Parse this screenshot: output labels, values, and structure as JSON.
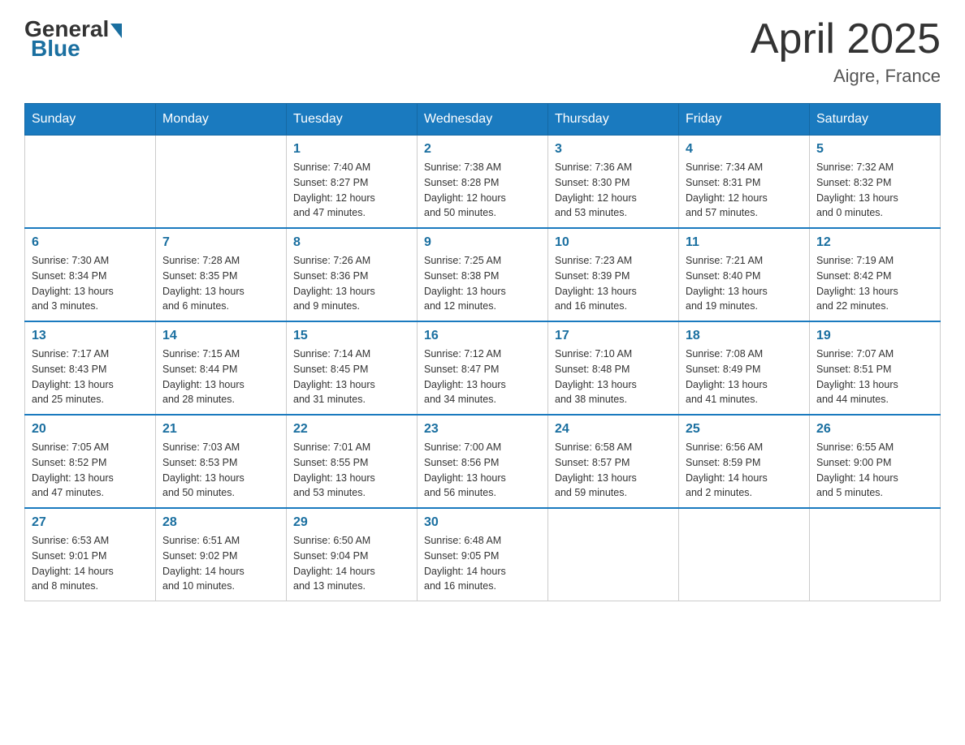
{
  "header": {
    "logo_general": "General",
    "logo_blue": "Blue",
    "month_title": "April 2025",
    "location": "Aigre, France"
  },
  "days_of_week": [
    "Sunday",
    "Monday",
    "Tuesday",
    "Wednesday",
    "Thursday",
    "Friday",
    "Saturday"
  ],
  "weeks": [
    [
      {
        "day": "",
        "info": ""
      },
      {
        "day": "",
        "info": ""
      },
      {
        "day": "1",
        "info": "Sunrise: 7:40 AM\nSunset: 8:27 PM\nDaylight: 12 hours\nand 47 minutes."
      },
      {
        "day": "2",
        "info": "Sunrise: 7:38 AM\nSunset: 8:28 PM\nDaylight: 12 hours\nand 50 minutes."
      },
      {
        "day": "3",
        "info": "Sunrise: 7:36 AM\nSunset: 8:30 PM\nDaylight: 12 hours\nand 53 minutes."
      },
      {
        "day": "4",
        "info": "Sunrise: 7:34 AM\nSunset: 8:31 PM\nDaylight: 12 hours\nand 57 minutes."
      },
      {
        "day": "5",
        "info": "Sunrise: 7:32 AM\nSunset: 8:32 PM\nDaylight: 13 hours\nand 0 minutes."
      }
    ],
    [
      {
        "day": "6",
        "info": "Sunrise: 7:30 AM\nSunset: 8:34 PM\nDaylight: 13 hours\nand 3 minutes."
      },
      {
        "day": "7",
        "info": "Sunrise: 7:28 AM\nSunset: 8:35 PM\nDaylight: 13 hours\nand 6 minutes."
      },
      {
        "day": "8",
        "info": "Sunrise: 7:26 AM\nSunset: 8:36 PM\nDaylight: 13 hours\nand 9 minutes."
      },
      {
        "day": "9",
        "info": "Sunrise: 7:25 AM\nSunset: 8:38 PM\nDaylight: 13 hours\nand 12 minutes."
      },
      {
        "day": "10",
        "info": "Sunrise: 7:23 AM\nSunset: 8:39 PM\nDaylight: 13 hours\nand 16 minutes."
      },
      {
        "day": "11",
        "info": "Sunrise: 7:21 AM\nSunset: 8:40 PM\nDaylight: 13 hours\nand 19 minutes."
      },
      {
        "day": "12",
        "info": "Sunrise: 7:19 AM\nSunset: 8:42 PM\nDaylight: 13 hours\nand 22 minutes."
      }
    ],
    [
      {
        "day": "13",
        "info": "Sunrise: 7:17 AM\nSunset: 8:43 PM\nDaylight: 13 hours\nand 25 minutes."
      },
      {
        "day": "14",
        "info": "Sunrise: 7:15 AM\nSunset: 8:44 PM\nDaylight: 13 hours\nand 28 minutes."
      },
      {
        "day": "15",
        "info": "Sunrise: 7:14 AM\nSunset: 8:45 PM\nDaylight: 13 hours\nand 31 minutes."
      },
      {
        "day": "16",
        "info": "Sunrise: 7:12 AM\nSunset: 8:47 PM\nDaylight: 13 hours\nand 34 minutes."
      },
      {
        "day": "17",
        "info": "Sunrise: 7:10 AM\nSunset: 8:48 PM\nDaylight: 13 hours\nand 38 minutes."
      },
      {
        "day": "18",
        "info": "Sunrise: 7:08 AM\nSunset: 8:49 PM\nDaylight: 13 hours\nand 41 minutes."
      },
      {
        "day": "19",
        "info": "Sunrise: 7:07 AM\nSunset: 8:51 PM\nDaylight: 13 hours\nand 44 minutes."
      }
    ],
    [
      {
        "day": "20",
        "info": "Sunrise: 7:05 AM\nSunset: 8:52 PM\nDaylight: 13 hours\nand 47 minutes."
      },
      {
        "day": "21",
        "info": "Sunrise: 7:03 AM\nSunset: 8:53 PM\nDaylight: 13 hours\nand 50 minutes."
      },
      {
        "day": "22",
        "info": "Sunrise: 7:01 AM\nSunset: 8:55 PM\nDaylight: 13 hours\nand 53 minutes."
      },
      {
        "day": "23",
        "info": "Sunrise: 7:00 AM\nSunset: 8:56 PM\nDaylight: 13 hours\nand 56 minutes."
      },
      {
        "day": "24",
        "info": "Sunrise: 6:58 AM\nSunset: 8:57 PM\nDaylight: 13 hours\nand 59 minutes."
      },
      {
        "day": "25",
        "info": "Sunrise: 6:56 AM\nSunset: 8:59 PM\nDaylight: 14 hours\nand 2 minutes."
      },
      {
        "day": "26",
        "info": "Sunrise: 6:55 AM\nSunset: 9:00 PM\nDaylight: 14 hours\nand 5 minutes."
      }
    ],
    [
      {
        "day": "27",
        "info": "Sunrise: 6:53 AM\nSunset: 9:01 PM\nDaylight: 14 hours\nand 8 minutes."
      },
      {
        "day": "28",
        "info": "Sunrise: 6:51 AM\nSunset: 9:02 PM\nDaylight: 14 hours\nand 10 minutes."
      },
      {
        "day": "29",
        "info": "Sunrise: 6:50 AM\nSunset: 9:04 PM\nDaylight: 14 hours\nand 13 minutes."
      },
      {
        "day": "30",
        "info": "Sunrise: 6:48 AM\nSunset: 9:05 PM\nDaylight: 14 hours\nand 16 minutes."
      },
      {
        "day": "",
        "info": ""
      },
      {
        "day": "",
        "info": ""
      },
      {
        "day": "",
        "info": ""
      }
    ]
  ]
}
